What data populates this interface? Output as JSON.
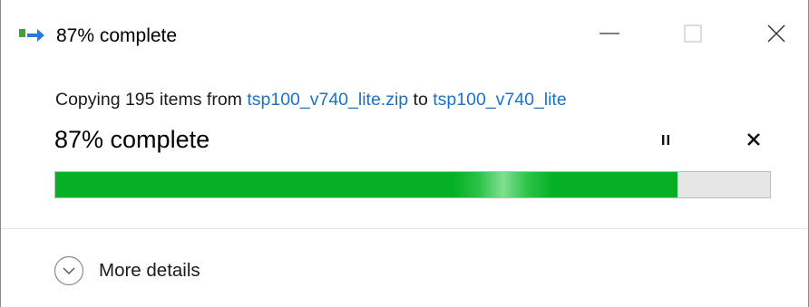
{
  "window": {
    "title": "87% complete",
    "minimize_label": "Minimize",
    "maximize_label": "Maximize",
    "close_label": "Close"
  },
  "copy": {
    "prefix": "Copying 195 items from ",
    "source": "tsp100_v740_lite.zip",
    "connector": " to ",
    "destination": "tsp100_v740_lite"
  },
  "progress": {
    "label": "87% complete",
    "fraction": 0.87,
    "bar_color": "#06b025",
    "track_color": "#e6e6e6"
  },
  "controls": {
    "pause_label": "Pause",
    "cancel_label": "Cancel"
  },
  "details": {
    "label": "More details"
  },
  "colors": {
    "link": "#1a73c8",
    "icon_green": "#3aa63a",
    "icon_blue": "#2a7bd4"
  }
}
